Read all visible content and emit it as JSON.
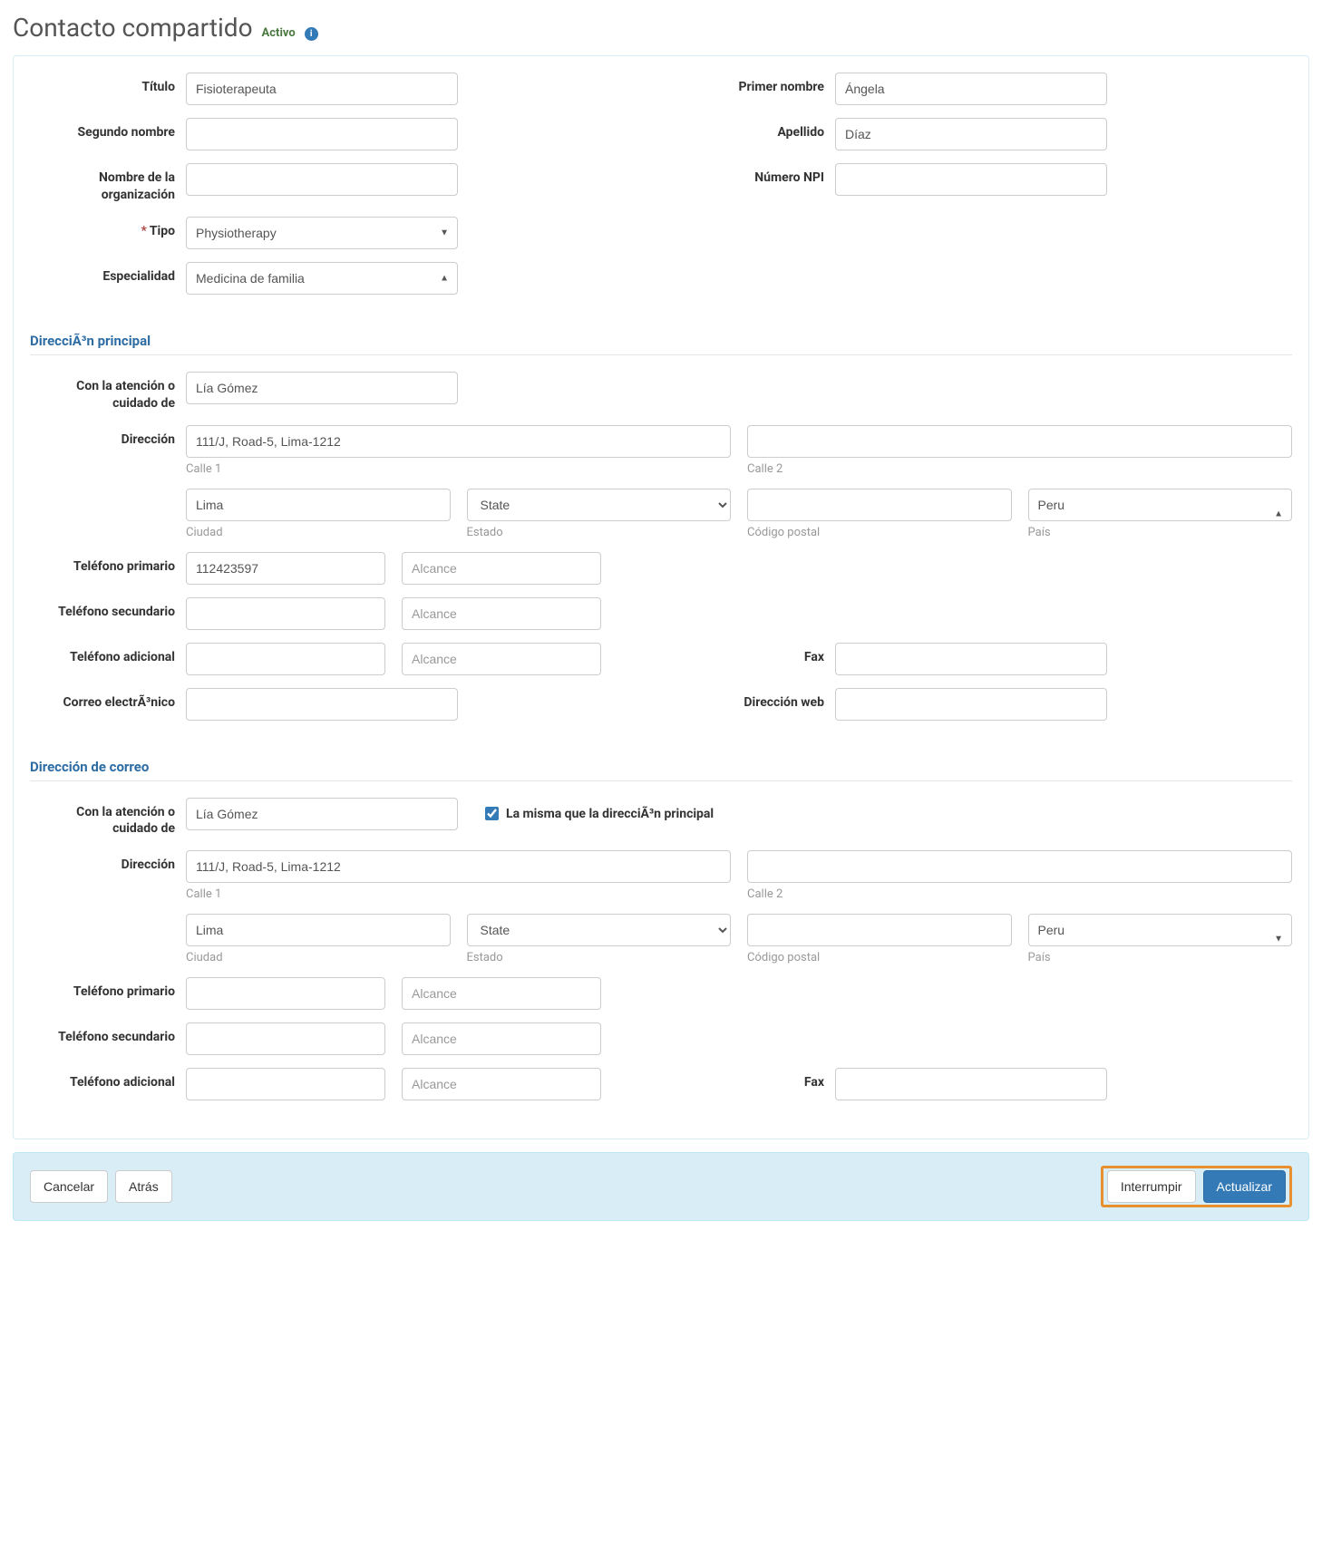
{
  "header": {
    "title": "Contacto compartido",
    "status": "Activo",
    "info_icon": "info-icon"
  },
  "labels": {
    "titulo": "Título",
    "primer_nombre": "Primer nombre",
    "segundo_nombre": "Segundo nombre",
    "apellido": "Apellido",
    "nombre_org": "Nombre de la organización",
    "numero_npi": "Número NPI",
    "tipo": "Tipo",
    "especialidad": "Especialidad",
    "direccion_principal": "DirecciÃ³n principal",
    "atencion": "Con la atención o cuidado de",
    "direccion": "Dirección",
    "calle1": "Calle 1",
    "calle2": "Calle 2",
    "ciudad": "Ciudad",
    "estado": "Estado",
    "codigo_postal": "Código postal",
    "pais": "País",
    "tel_primario": "Teléfono primario",
    "tel_secundario": "Teléfono secundario",
    "tel_adicional": "Teléfono adicional",
    "fax": "Fax",
    "correo": "Correo electrÃ³nico",
    "direccion_web": "Dirección web",
    "direccion_correo": "Dirección de correo",
    "same_as_main": "La misma que la direcciÃ³n principal",
    "alcance_ph": "Alcance",
    "state_ph": "State"
  },
  "values": {
    "titulo": "Fisioterapeuta",
    "primer_nombre": "Ángela",
    "segundo_nombre": "",
    "apellido": "Díaz",
    "nombre_org": "",
    "numero_npi": "",
    "tipo": "Physiotherapy",
    "especialidad": "Medicina de familia",
    "main": {
      "atencion": "Lía Gómez",
      "calle1": "111/J, Road-5, Lima-1212",
      "calle2": "",
      "ciudad": "Lima",
      "estado": "State",
      "codigo_postal": "",
      "pais": "Peru",
      "tel_primario": "112423597",
      "tel_primario_ext": "",
      "tel_secundario": "",
      "tel_secundario_ext": "",
      "tel_adicional": "",
      "tel_adicional_ext": "",
      "fax": "",
      "correo": "",
      "web": ""
    },
    "mail": {
      "same_checked": true,
      "atencion": "Lía Gómez",
      "calle1": "111/J, Road-5, Lima-1212",
      "calle2": "",
      "ciudad": "Lima",
      "estado": "State",
      "codigo_postal": "",
      "pais": "Peru",
      "tel_primario": "",
      "tel_primario_ext": "",
      "tel_secundario": "",
      "tel_secundario_ext": "",
      "tel_adicional": "",
      "tel_adicional_ext": "",
      "fax": ""
    }
  },
  "footer": {
    "cancelar": "Cancelar",
    "atras": "Atrás",
    "interrumpir": "Interrumpir",
    "actualizar": "Actualizar"
  }
}
